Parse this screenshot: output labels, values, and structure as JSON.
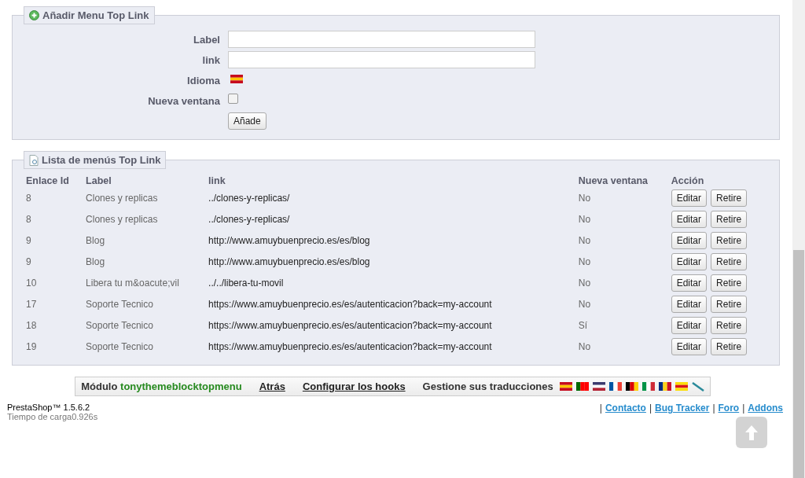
{
  "add_form": {
    "legend": "Añadir Menu Top Link",
    "fields": [
      {
        "kind": "text",
        "label": "Label"
      },
      {
        "kind": "text",
        "label": "link"
      },
      {
        "kind": "flag",
        "label": "Idioma"
      },
      {
        "kind": "checkbox",
        "label": "Nueva ventana",
        "checked": false
      }
    ],
    "submit": "Añade"
  },
  "list": {
    "legend": "Lista de menús Top Link",
    "columns": [
      "Enlace Id",
      "Label",
      "link",
      "Nueva ventana",
      "Acción"
    ],
    "rows": [
      {
        "id": "8",
        "label": "Clones y replicas",
        "link": "../clones-y-replicas/",
        "new_window": "No",
        "edit": "Editar",
        "remove": "Retire"
      },
      {
        "id": "8",
        "label": "Clones y replicas",
        "link": "../clones-y-replicas/",
        "new_window": "No",
        "edit": "Editar",
        "remove": "Retire"
      },
      {
        "id": "9",
        "label": "Blog",
        "link": "http://www.amuybuenprecio.es/es/blog",
        "new_window": "No",
        "edit": "Editar",
        "remove": "Retire"
      },
      {
        "id": "9",
        "label": "Blog",
        "link": "http://www.amuybuenprecio.es/es/blog",
        "new_window": "No",
        "edit": "Editar",
        "remove": "Retire"
      },
      {
        "id": "10",
        "label": "Libera tu m&oacute;vil",
        "link": "../../libera-tu-movil",
        "new_window": "No",
        "edit": "Editar",
        "remove": "Retire"
      },
      {
        "id": "17",
        "label": "Soporte Tecnico",
        "link": "https://www.amuybuenprecio.es/es/autenticacion?back=my-account",
        "new_window": "No",
        "edit": "Editar",
        "remove": "Retire"
      },
      {
        "id": "18",
        "label": "Soporte Tecnico",
        "link": "https://www.amuybuenprecio.es/es/autenticacion?back=my-account",
        "new_window": "Sí",
        "edit": "Editar",
        "remove": "Retire"
      },
      {
        "id": "19",
        "label": "Soporte Tecnico",
        "link": "https://www.amuybuenprecio.es/es/autenticacion?back=my-account",
        "new_window": "No",
        "edit": "Editar",
        "remove": "Retire"
      }
    ]
  },
  "module_bar": {
    "prefix": "Módulo",
    "module_name": "tonythemeblocktopmenu",
    "links": [
      "Atrás",
      "Configurar los hooks"
    ],
    "translations_label": "Gestione sus traducciones"
  },
  "footer": {
    "version": "PrestaShop™ 1.5.6.2",
    "load_time": "Tiempo de carga0.926s",
    "separator": "|",
    "links": [
      "Contacto",
      "Bug Tracker",
      "Foro",
      "Addons"
    ]
  }
}
